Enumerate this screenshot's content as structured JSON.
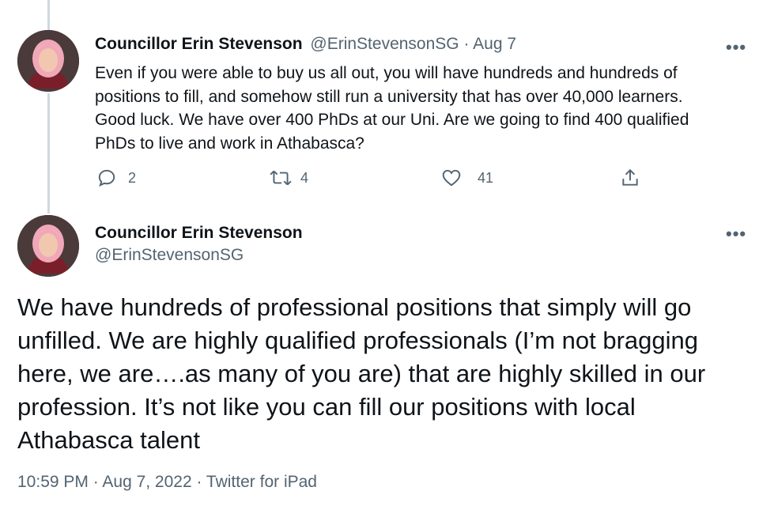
{
  "reply_tweet": {
    "author_name": "Councillor Erin Stevenson",
    "handle_date": "@ErinStevensonSG · Aug 7",
    "more_label": "•••",
    "text": "Even if you were able to buy us all out, you will have hundreds and hundreds of positions to fill, and somehow still run a university that has over 40,000 learners. Good luck. We have over 400 PhDs at our Uni. Are we going to find 400 qualified PhDs to live and work in Athabasca?",
    "actions": {
      "reply_count": "2",
      "retweet_count": "4",
      "like_count": "41"
    }
  },
  "main_tweet": {
    "author_name": "Councillor Erin Stevenson",
    "handle": "@ErinStevensonSG",
    "more_label": "•••",
    "text": "We have hundreds of professional positions that simply will go unfilled. We are highly qualified professionals (I’m not bragging here, we are….as many of you are) that are highly skilled in our profession. It’s not like you can fill our positions with local Athabasca talent",
    "footer": "10:59 PM · Aug 7, 2022 · Twitter for iPad"
  },
  "icons": [
    "avatar",
    "more-icon",
    "reply-icon",
    "retweet-icon",
    "like-icon",
    "share-icon"
  ],
  "colors": {
    "text": "#0f1419",
    "secondary": "#536471",
    "thread_line": "#cfd9de"
  }
}
